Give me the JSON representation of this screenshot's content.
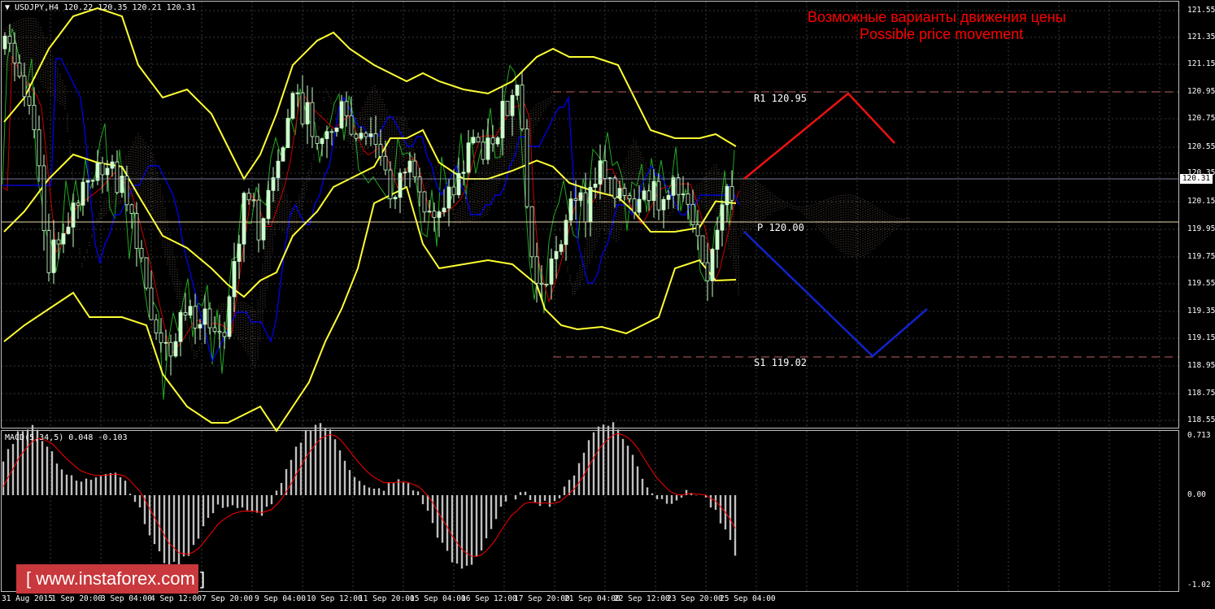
{
  "chart_header": {
    "symbol_line": "USDJPY,H4  120.22 120.35 120.21 120.31",
    "macd_line": "MACD(5,34,5) 0.048 -0.103"
  },
  "forecast": {
    "title_ru": "Возможные варианты движения цены",
    "title_en": "Possible price movement",
    "r1_label": "R1 120.95",
    "pivot_label": "P 120.00",
    "s1_label": "S1 119.02"
  },
  "current_price": "120.31",
  "price_axis": [
    "121.55",
    "121.35",
    "121.15",
    "120.95",
    "120.75",
    "120.55",
    "120.35",
    "120.15",
    "119.95",
    "119.75",
    "119.55",
    "119.35",
    "119.15",
    "118.95",
    "118.75",
    "118.55"
  ],
  "macd_axis": [
    "0.713",
    "0.00",
    "-1.02"
  ],
  "time_axis": [
    "31 Aug 2015",
    "1 Sep 20:00",
    "3 Sep 04:00",
    "4 Sep 12:00",
    "7 Sep 20:00",
    "9 Sep 04:00",
    "10 Sep 12:00",
    "11 Sep 20:00",
    "15 Sep 04:00",
    "16 Sep 12:00",
    "17 Sep 20:00",
    "21 Sep 04:00",
    "22 Sep 12:00",
    "23 Sep 20:00",
    "25 Sep 04:00"
  ],
  "watermark": {
    "text": "www.instaforex.com"
  },
  "colors": {
    "background": "#000000",
    "bull_candle": "#ccffcc",
    "bear_candle": "#000000",
    "bollinger": "#ffff33",
    "fast_ma": "#cc0000",
    "slow_ma": "#0000ff",
    "forecast_up": "#ee1111",
    "forecast_down": "#1122cc",
    "macd_hist": "#c0c0c0",
    "macd_signal": "#ff0000",
    "brand": "#c8383c"
  }
}
